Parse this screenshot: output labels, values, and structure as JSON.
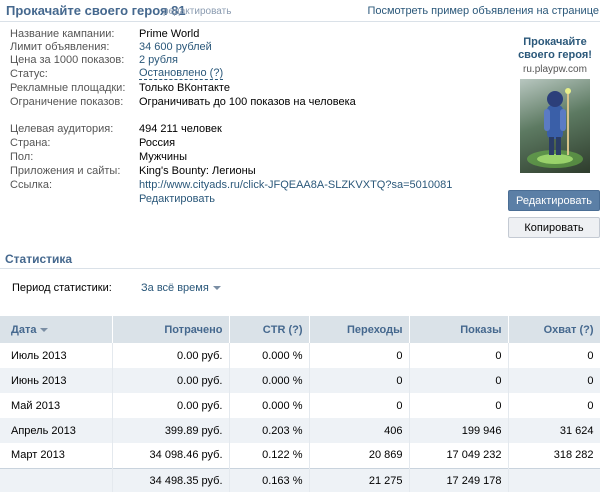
{
  "header": {
    "title": "Прокачайте своего героя 81",
    "edit_link": "редактировать",
    "example_link": "Посмотреть пример объявления на странице"
  },
  "campaign": {
    "rows": [
      {
        "label": "Название кампании:",
        "value": "Prime World"
      },
      {
        "label": "Лимит объявления:",
        "value": "34 600 рублей"
      },
      {
        "label": "Цена за 1000 показов:",
        "value": "2 рубля"
      },
      {
        "label": "Статус:",
        "value": "Остановлено (?)"
      },
      {
        "label": "Рекламные площадки:",
        "value": "Только ВКонтакте"
      },
      {
        "label": "Ограничение показов:",
        "value": "Ограничивать до 100 показов на человека"
      }
    ]
  },
  "audience": {
    "rows": [
      {
        "label": "Целевая аудитория:",
        "value": "494 211 человек"
      },
      {
        "label": "Страна:",
        "value": "Россия"
      },
      {
        "label": "Пол:",
        "value": "Мужчины"
      },
      {
        "label": "Приложения и сайты:",
        "value": "King's Bounty: Легионы"
      },
      {
        "label": "Ссылка:",
        "value": "http://www.cityads.ru/click-JFQEAA8A-SLZKVXTQ?sa=5010081"
      }
    ],
    "edit_link": "Редактировать"
  },
  "preview": {
    "title": "Прокачайте своего героя!",
    "domain": "ru.playpw.com"
  },
  "buttons": {
    "edit": "Редактировать",
    "copy": "Копировать"
  },
  "stats": {
    "title": "Статистика",
    "period_label": "Период статистики:",
    "period_value": "За всё время",
    "columns": [
      "Дата",
      "Потрачено",
      "CTR (?)",
      "Переходы",
      "Показы",
      "Охват (?)"
    ],
    "rows": [
      [
        "Июль 2013",
        "0.00 руб.",
        "0.000 %",
        "0",
        "0",
        "0"
      ],
      [
        "Июнь 2013",
        "0.00 руб.",
        "0.000 %",
        "0",
        "0",
        "0"
      ],
      [
        "Май 2013",
        "0.00 руб.",
        "0.000 %",
        "0",
        "0",
        "0"
      ],
      [
        "Апрель 2013",
        "399.89 руб.",
        "0.203 %",
        "406",
        "199 946",
        "31 624"
      ],
      [
        "Март 2013",
        "34 098.46 руб.",
        "0.122 %",
        "20 869",
        "17 049 232",
        "318 282"
      ]
    ],
    "total": [
      "",
      "34 498.35 руб.",
      "0.163 %",
      "21 275",
      "17 249 178",
      ""
    ]
  },
  "colors": {
    "accent": "#45688e",
    "link": "#2b587a",
    "header_bg": "#dae2e8",
    "button_primary": "#5b7fa6"
  }
}
